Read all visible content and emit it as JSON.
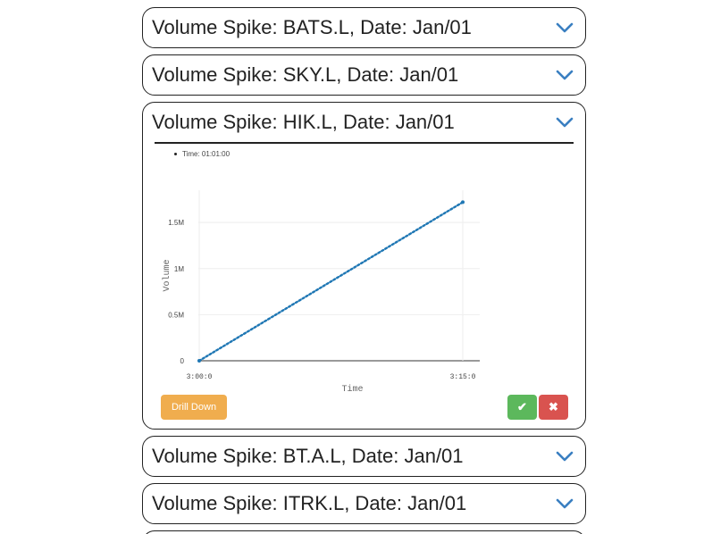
{
  "panels": [
    {
      "title": "Volume Spike: BATS.L, Date: Jan/01",
      "expanded": false
    },
    {
      "title": "Volume Spike: SKY.L, Date: Jan/01",
      "expanded": false
    },
    {
      "title": "Volume Spike: HIK.L, Date: Jan/01",
      "expanded": true
    },
    {
      "title": "Volume Spike: BT.A.L, Date: Jan/01",
      "expanded": false
    },
    {
      "title": "Volume Spike: ITRK.L, Date: Jan/01",
      "expanded": false
    }
  ],
  "detail": {
    "legend_text": "Time: 01:01:00",
    "drill_down_label": "Drill Down",
    "accept_icon": "check-icon",
    "reject_icon": "close-icon",
    "accept_glyph": "✔",
    "reject_glyph": "✖"
  },
  "colors": {
    "accent": "#3a7fc1",
    "line": "#1f77b4",
    "drill": "#f0ad4e",
    "accept": "#5cb85c",
    "reject": "#d9534f"
  },
  "chart_data": {
    "type": "line",
    "title": "",
    "xlabel": "Time",
    "ylabel": "Volume",
    "x": [
      "3:00:0",
      "3:15:0"
    ],
    "series": [
      {
        "values": [
          0,
          1720000
        ]
      }
    ],
    "yticks": [
      0,
      500000,
      1000000,
      1500000
    ],
    "ytick_labels": [
      "0",
      "0.5M",
      "1M",
      "1.5M"
    ],
    "ylim": [
      0,
      1850000
    ],
    "grid": true,
    "line_style": "dotted"
  }
}
